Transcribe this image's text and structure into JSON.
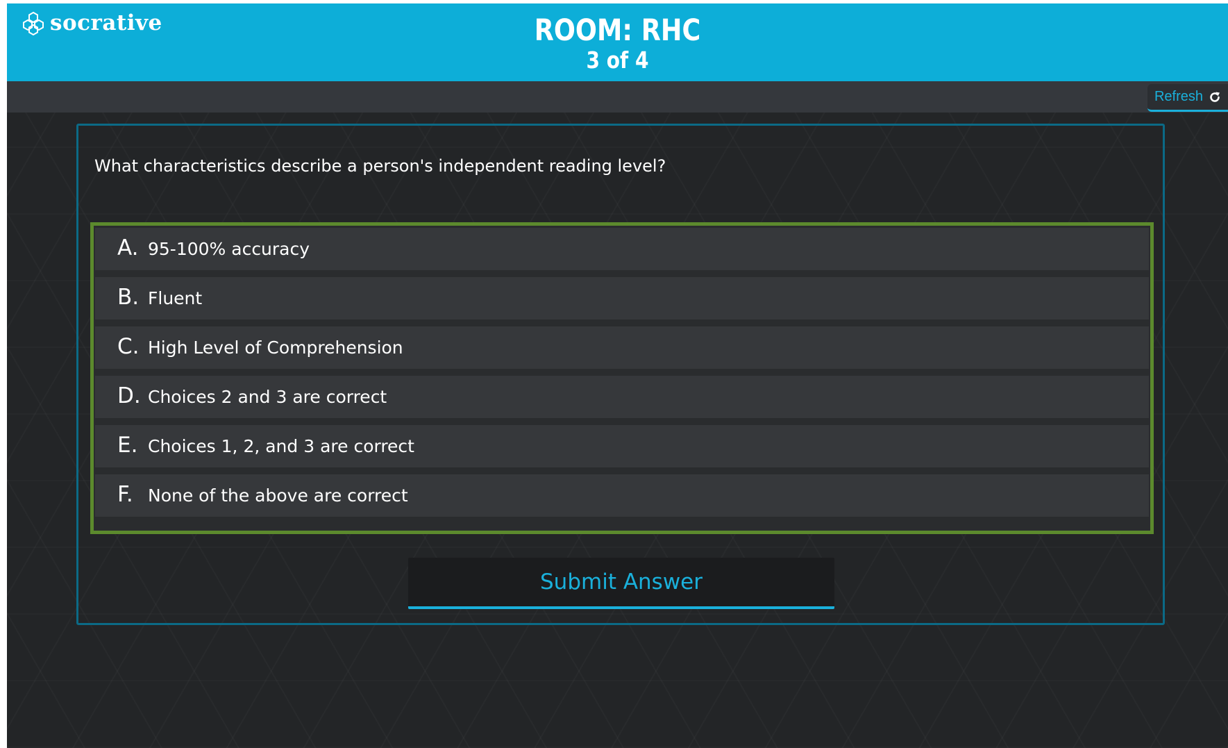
{
  "app": {
    "brand": "socrative",
    "logo_icon": "socrative-hexagon-icon"
  },
  "header": {
    "room_title": "ROOM: RHC",
    "progress": "3 of 4"
  },
  "toolbar": {
    "refresh_label": "Refresh",
    "refresh_icon": "refresh-icon"
  },
  "question": {
    "text": "What characteristics describe a person's independent reading level?",
    "choices": [
      {
        "letter": "A.",
        "text": "95-100% accuracy"
      },
      {
        "letter": "B.",
        "text": "Fluent"
      },
      {
        "letter": "C.",
        "text": "High Level of Comprehension"
      },
      {
        "letter": "D.",
        "text": "Choices 2 and 3 are correct"
      },
      {
        "letter": "E.",
        "text": "Choices 1, 2, and 3 are correct"
      },
      {
        "letter": "F.",
        "text": "None of the above are correct"
      }
    ],
    "submit_label": "Submit Answer"
  },
  "colors": {
    "header": "#0daed8",
    "accent": "#1ab0db",
    "choices_border": "#5c8a2d",
    "panel_border": "#0b6a86",
    "background": "#232527"
  }
}
